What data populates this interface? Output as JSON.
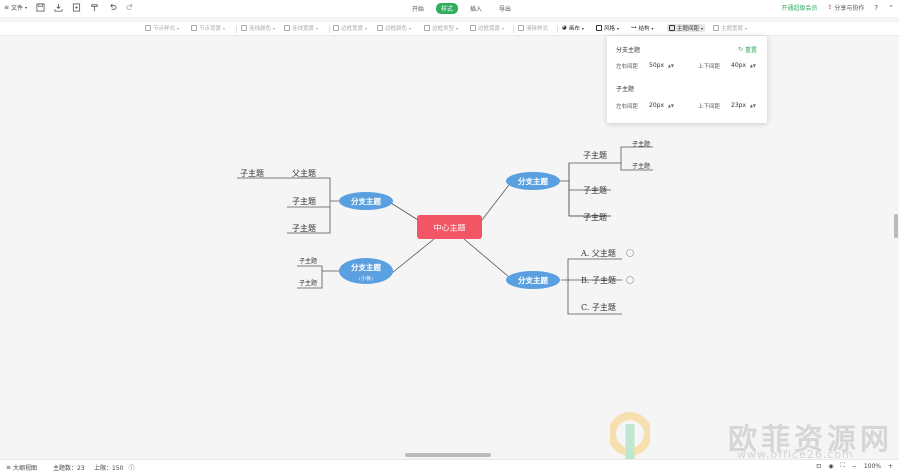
{
  "topbar": {
    "file_label": "文件",
    "tabs": [
      {
        "label": "开始",
        "active": false
      },
      {
        "label": "样式",
        "active": true
      },
      {
        "label": "插入",
        "active": false
      },
      {
        "label": "导出",
        "active": false
      }
    ],
    "vip_label": "开通超级会员",
    "share_label": "分享与协作",
    "help_label": "?"
  },
  "toolbar": {
    "items": [
      {
        "label": "节点样式",
        "enabled": false
      },
      {
        "label": "节点背景",
        "enabled": false
      },
      {
        "label": "连线颜色",
        "enabled": false
      },
      {
        "label": "连线宽度",
        "enabled": false
      },
      {
        "label": "边框宽度",
        "enabled": false
      },
      {
        "label": "边框颜色",
        "enabled": false
      },
      {
        "label": "边框类型",
        "enabled": false
      },
      {
        "label": "边框弧度",
        "enabled": false
      },
      {
        "label": "清除样式",
        "enabled": false
      },
      {
        "label": "画布",
        "enabled": true
      },
      {
        "label": "风格",
        "enabled": true
      },
      {
        "label": "结构",
        "enabled": true
      },
      {
        "label": "主题间距",
        "enabled": true
      },
      {
        "label": "主题宽度",
        "enabled": false
      }
    ]
  },
  "spacing_panel": {
    "branch_title": "分支主题",
    "reset_label": "重置",
    "branch_h_label": "左右间距",
    "branch_h_value": "50px",
    "branch_v_label": "上下间距",
    "branch_v_value": "40px",
    "sub_title": "子主题",
    "sub_h_label": "左右间距",
    "sub_h_value": "20px",
    "sub_v_label": "上下间距",
    "sub_v_value": "23px"
  },
  "mindmap": {
    "center": "中心主题",
    "branch_upper_right": "分支主题",
    "branch_lower_right": "分支主题",
    "branch_upper_left": "分支主题",
    "branch_lower_left": "分支主题",
    "branch_lower_left_note": "(小板)",
    "father_topic": "父主题",
    "left_far_topic": "子主题",
    "left_upper_sub_1": "子主题",
    "left_upper_sub_2": "子主题",
    "left_lower_sub_1": "子主题",
    "left_lower_sub_2": "子主题",
    "ur_sub_1": "子主题",
    "ur_sub_1_child_1": "子主题",
    "ur_sub_1_child_2": "子主题",
    "ur_sub_2": "子主题",
    "ur_sub_3": "子主题",
    "lr_sub_1": "A. 父主题",
    "lr_sub_2": "B. 子主题",
    "lr_sub_3": "C. 子主题",
    "colors": {
      "center": "#f25563",
      "branch": "#5a9fe0",
      "line": "#555555"
    }
  },
  "status": {
    "outline_label": "大纲视图",
    "topic_count_label": "主题数：23",
    "limit_label": "上限：150",
    "zoom_label": "100%"
  },
  "watermark": {
    "big": "欧菲资源网",
    "url": "www.office26.com"
  }
}
